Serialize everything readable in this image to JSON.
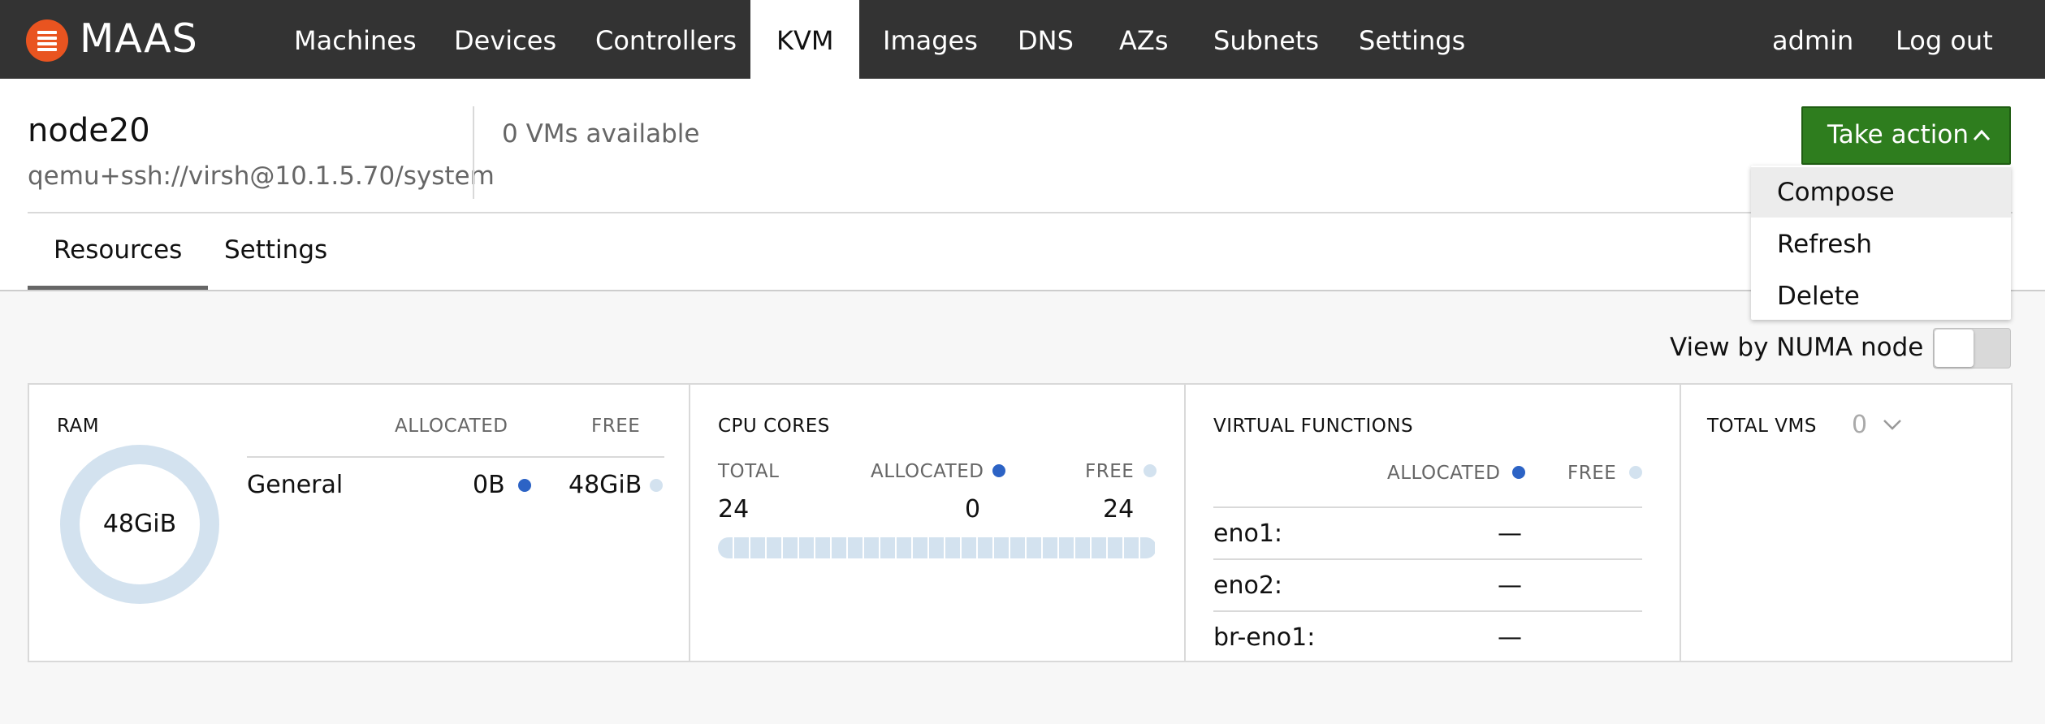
{
  "nav": {
    "brand": "MAAS",
    "links": [
      "Machines",
      "Devices",
      "Controllers",
      "KVM",
      "Images",
      "DNS",
      "AZs",
      "Subnets",
      "Settings"
    ],
    "active": "KVM",
    "user": "admin",
    "logout": "Log out"
  },
  "pod": {
    "name": "node20",
    "address": "qemu+ssh://virsh@10.1.5.70/system",
    "vms_available": "0 VMs available"
  },
  "tabs": [
    "Resources",
    "Settings"
  ],
  "take_action": {
    "label": "Take action",
    "items": [
      "Compose",
      "Refresh",
      "Delete"
    ]
  },
  "numa_toggle": {
    "label": "View by NUMA node",
    "on": false
  },
  "ram": {
    "title": "RAM",
    "col_allocated": "ALLOCATED",
    "col_free": "FREE",
    "donut_label": "48GiB",
    "row_name": "General",
    "allocated": "0B",
    "free": "48GiB"
  },
  "cpu": {
    "title": "CPU CORES",
    "col_total": "TOTAL",
    "col_allocated": "ALLOCATED",
    "col_free": "FREE",
    "total": "24",
    "allocated": "0",
    "free": "24"
  },
  "vf": {
    "title": "VIRTUAL FUNCTIONS",
    "col_allocated": "ALLOCATED",
    "col_free": "FREE",
    "rows": [
      {
        "name": "eno1:",
        "value": "—"
      },
      {
        "name": "eno2:",
        "value": "—"
      },
      {
        "name": "br-eno1:",
        "value": "—"
      }
    ]
  },
  "total_vms": {
    "title": "TOTAL VMS",
    "count": "0"
  },
  "colors": {
    "nav_bg": "#333333",
    "brand_orange": "#e95420",
    "action_green": "#2e7d1e",
    "allocated_blue": "#2c63c5",
    "free_lightblue": "#d3e2ef"
  }
}
